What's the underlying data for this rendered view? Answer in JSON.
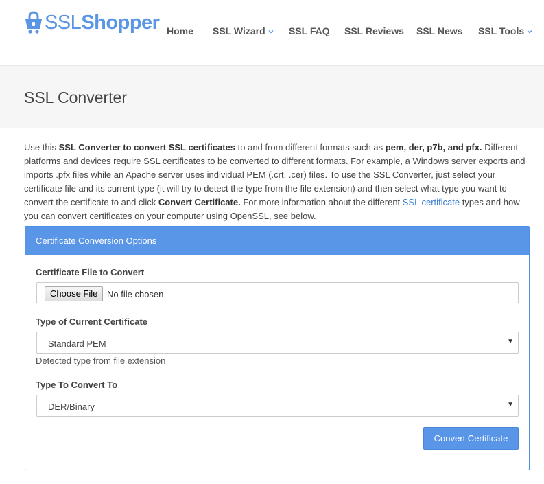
{
  "logo": {
    "part1": "SSL",
    "part2": "Shopper",
    "icon": "shopping-cart-lock-icon",
    "color": "#5a96e3"
  },
  "nav": {
    "items": [
      {
        "label": "Home",
        "dropdown": false
      },
      {
        "label": "SSL Wizard",
        "dropdown": true
      },
      {
        "label": "SSL FAQ",
        "dropdown": false
      },
      {
        "label": "SSL Reviews",
        "dropdown": false
      },
      {
        "label": "SSL News",
        "dropdown": false
      },
      {
        "label": "SSL Tools",
        "dropdown": true
      }
    ]
  },
  "page": {
    "title": "SSL Converter"
  },
  "intro": {
    "t1": "Use this ",
    "b1": "SSL Converter to convert SSL certificates",
    "t2": " to and from different formats such as ",
    "b2": "pem, der, p7b, and pfx.",
    "t3": " Different platforms and devices require SSL certificates to be converted to different formats. For example, a Windows server exports and imports .pfx files while an Apache server uses individual PEM (.crt, .cer) files. To use the SSL Converter, just select your certificate file and its current type (it will try to detect the type from the file extension) and then select what type you want to convert the certificate to and click ",
    "b3": "Convert Certificate.",
    "t4": " For more information about the different ",
    "link": "SSL certificate",
    "t5": " types and how you can convert certificates on your computer using OpenSSL, see below."
  },
  "panel": {
    "heading": "Certificate Conversion Options",
    "file_label": "Certificate File to Convert",
    "choose_button": "Choose File",
    "file_status": "No file chosen",
    "current_type_label": "Type of Current Certificate",
    "current_type_value": "Standard PEM",
    "detected_help": "Detected type from file extension",
    "convert_to_label": "Type To Convert To",
    "convert_to_value": "DER/Binary",
    "convert_button": "Convert Certificate"
  },
  "colors": {
    "accent": "#5a96e8",
    "link": "#3a7fd5",
    "title_band": "#f6f6f6"
  }
}
